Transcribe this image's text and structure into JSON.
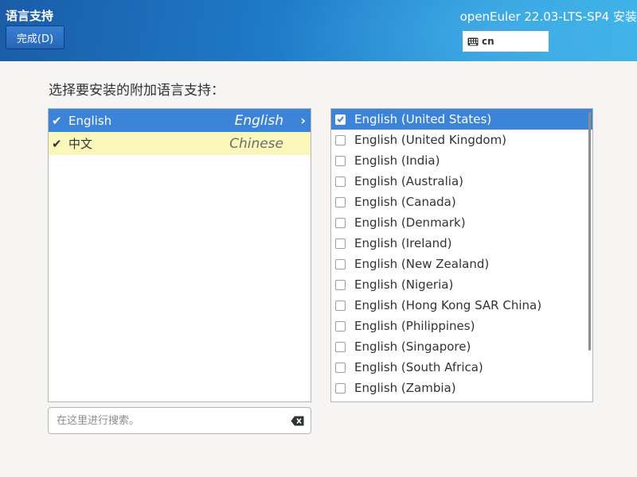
{
  "header": {
    "screen_title": "语言支持",
    "done_label": "完成(D)",
    "product_title": "openEuler 22.03-LTS-SP4 安装",
    "keyboard_layout": "cn",
    "keyboard_icon": "keyboard-icon"
  },
  "prompt": "选择要安装的附加语言支持：",
  "languages": [
    {
      "native": "English",
      "english": "English",
      "checked": true,
      "selected": true
    },
    {
      "native": "中文",
      "english": "Chinese",
      "checked": true,
      "selected": false
    }
  ],
  "search": {
    "placeholder": "在这里进行搜索。",
    "value": ""
  },
  "locales": [
    {
      "label": "English (United States)",
      "checked": true,
      "selected": true
    },
    {
      "label": "English (United Kingdom)",
      "checked": false
    },
    {
      "label": "English (India)",
      "checked": false
    },
    {
      "label": "English (Australia)",
      "checked": false
    },
    {
      "label": "English (Canada)",
      "checked": false
    },
    {
      "label": "English (Denmark)",
      "checked": false
    },
    {
      "label": "English (Ireland)",
      "checked": false
    },
    {
      "label": "English (New Zealand)",
      "checked": false
    },
    {
      "label": "English (Nigeria)",
      "checked": false
    },
    {
      "label": "English (Hong Kong SAR China)",
      "checked": false
    },
    {
      "label": "English (Philippines)",
      "checked": false
    },
    {
      "label": "English (Singapore)",
      "checked": false
    },
    {
      "label": "English (South Africa)",
      "checked": false
    },
    {
      "label": "English (Zambia)",
      "checked": false
    }
  ],
  "colors": {
    "accent": "#3c84d8",
    "chosen_row": "#fbf7bb",
    "header_start": "#1a5ca8",
    "header_end": "#3ab2e6"
  }
}
